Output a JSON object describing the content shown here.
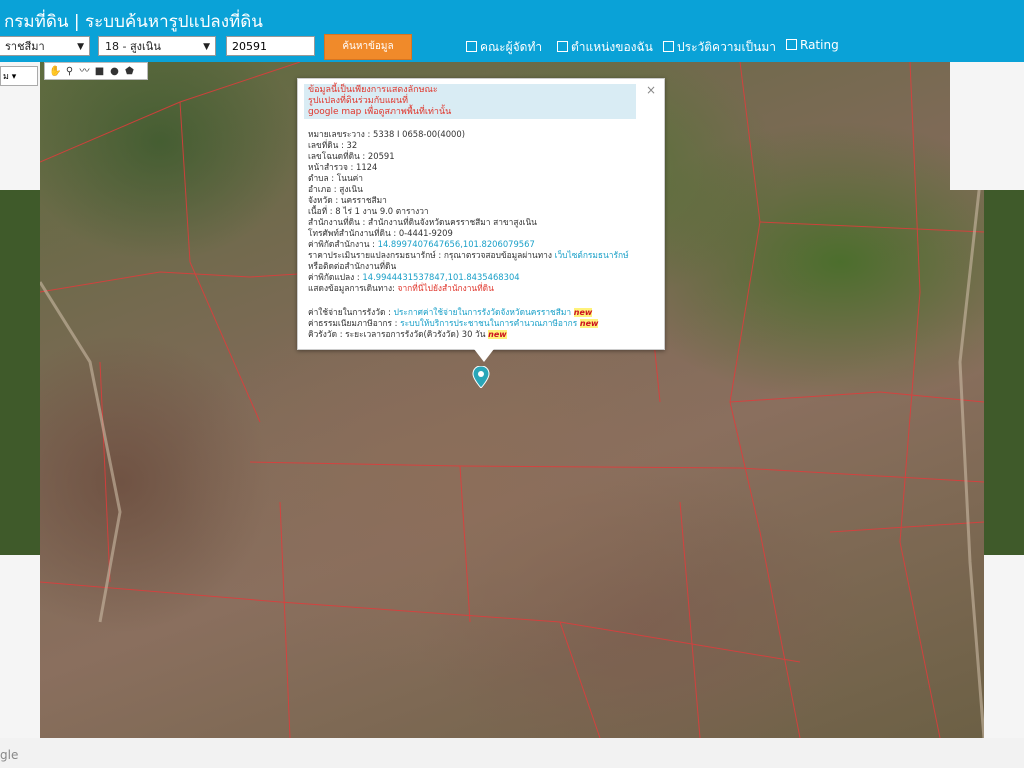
{
  "header": {
    "title": "กรมที่ดิน | ระบบค้นหารูปแปลงที่ดิน",
    "province_select": "ราชสีมา",
    "district_select": "18 - สูงเนิน",
    "parcel_number": "20591",
    "search_button": "ค้นหาข้อมูล",
    "checkboxes": [
      "คณะผู้จัดทำ",
      "ตำแหน่งของฉัน",
      "ประวัติความเป็นมา",
      "Rating"
    ]
  },
  "map": {
    "mini_select": "ม",
    "google_text": "gle"
  },
  "popup": {
    "close": "×",
    "notice": [
      "ข้อมูลนี้เป็นเพียงการแสดงลักษณะ",
      "รูปแปลงที่ดินร่วมกับแผนที่",
      "google map เพื่อดูสภาพพื้นที่เท่านั้น"
    ],
    "fields": [
      {
        "text": "หมายเลขระวาง : 5338 I 0658-00(4000)"
      },
      {
        "text": "เลขที่ดิน : 32"
      },
      {
        "text": "เลขโฉนดที่ดิน : 20591"
      },
      {
        "text": "หน้าสำรวจ : 1124"
      },
      {
        "text": "ตำบล : โนนค่า"
      },
      {
        "text": "อำเภอ : สูงเนิน"
      },
      {
        "text": "จังหวัด : นครราชสีมา"
      },
      {
        "text": "เนื้อที่ : 8 ไร่ 1 งาน 9.0 ตารางวา"
      },
      {
        "text": "สำนักงานที่ดิน : สำนักงานที่ดินจังหวัดนครราชสีมา สาขาสูงเนิน"
      },
      {
        "text": "โทรศัพท์สำนักงานที่ดิน : 0-4441-9209"
      }
    ],
    "office_coord_label": "ค่าพิกัดสำนักงาน : ",
    "office_coord_value": "14.8997407647656,101.8206079567",
    "appraisal_label": "ราคาประเมินรายแปลงกรมธนารักษ์ : กรุณาตรวจสอบข้อมูลผ่านทาง ",
    "appraisal_link": "เว็บไซต์กรมธนารักษ์",
    "appraisal_cont": "หรือติดต่อสำนักงานที่ดิน",
    "parcel_coord_label": "ค่าพิกัดแปลง : ",
    "parcel_coord_value": "14.9944431537847,101.8435468304",
    "route_label": "แสดงข้อมูลการเดินทาง: ",
    "route_link": "จากที่นี่ไปยังสำนักงานที่ดิน",
    "fee_label": "ค่าใช้จ่ายในการรังวัด : ",
    "fee_link": "ประกาศค่าใช้จ่ายในการรังวัดจังหวัดนครราชสีมา",
    "tax_label": "ค่าธรรมเนียมภาษีอากร : ",
    "tax_link": "ระบบให้บริการประชาชนในการคำนวณภาษีอากร",
    "queue_text": "คิวรังวัด : ระยะเวลารอการรังวัด(คิวรังวัด) 30 วัน",
    "new_badge": "new"
  }
}
